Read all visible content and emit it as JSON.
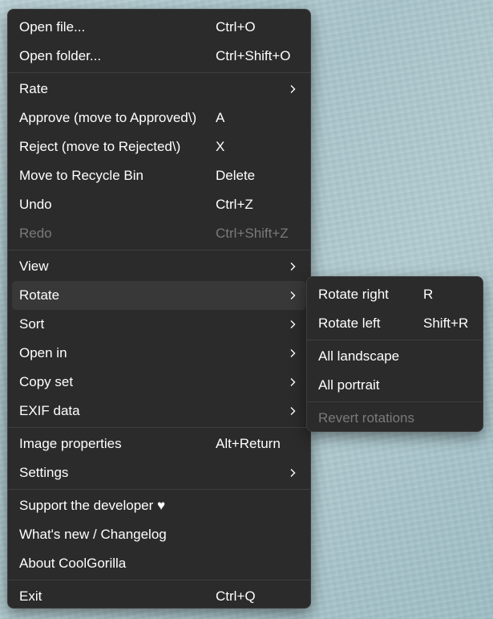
{
  "main_menu": {
    "groups": [
      [
        {
          "label": "Open file...",
          "shortcut": "Ctrl+O"
        },
        {
          "label": "Open folder...",
          "shortcut": "Ctrl+Shift+O"
        }
      ],
      [
        {
          "label": "Rate",
          "shortcut": "",
          "submenu": true
        },
        {
          "label": "Approve (move to Approved\\)",
          "shortcut": "A"
        },
        {
          "label": "Reject (move to Rejected\\)",
          "shortcut": "X"
        },
        {
          "label": "Move to Recycle Bin",
          "shortcut": "Delete"
        },
        {
          "label": "Undo",
          "shortcut": "Ctrl+Z"
        },
        {
          "label": "Redo",
          "shortcut": "Ctrl+Shift+Z",
          "disabled": true
        }
      ],
      [
        {
          "label": "View",
          "shortcut": "",
          "submenu": true
        },
        {
          "label": "Rotate",
          "shortcut": "",
          "submenu": true,
          "highlighted": true
        },
        {
          "label": "Sort",
          "shortcut": "",
          "submenu": true
        },
        {
          "label": "Open in",
          "shortcut": "",
          "submenu": true
        },
        {
          "label": "Copy set",
          "shortcut": "",
          "submenu": true
        },
        {
          "label": "EXIF data",
          "shortcut": "",
          "submenu": true
        }
      ],
      [
        {
          "label": "Image properties",
          "shortcut": "Alt+Return"
        },
        {
          "label": "Settings",
          "shortcut": "",
          "submenu": true
        }
      ],
      [
        {
          "label": "Support the developer ♥",
          "shortcut": ""
        },
        {
          "label": "What's new / Changelog",
          "shortcut": ""
        },
        {
          "label": "About CoolGorilla",
          "shortcut": ""
        }
      ],
      [
        {
          "label": "Exit",
          "shortcut": "Ctrl+Q"
        }
      ]
    ]
  },
  "rotate_submenu": {
    "groups": [
      [
        {
          "label": "Rotate right",
          "shortcut": "R"
        },
        {
          "label": "Rotate left",
          "shortcut": "Shift+R"
        }
      ],
      [
        {
          "label": "All landscape",
          "shortcut": ""
        },
        {
          "label": "All portrait",
          "shortcut": ""
        }
      ],
      [
        {
          "label": "Revert rotations",
          "shortcut": "",
          "disabled": true
        }
      ]
    ]
  },
  "colors": {
    "menu_background": "#2b2b2b",
    "highlight": "#383838",
    "text": "#ffffff",
    "disabled_text": "#7a7a7a",
    "separator": "#3f3f3f"
  },
  "icons": {
    "submenu_indicator": "chevron-right-icon"
  }
}
